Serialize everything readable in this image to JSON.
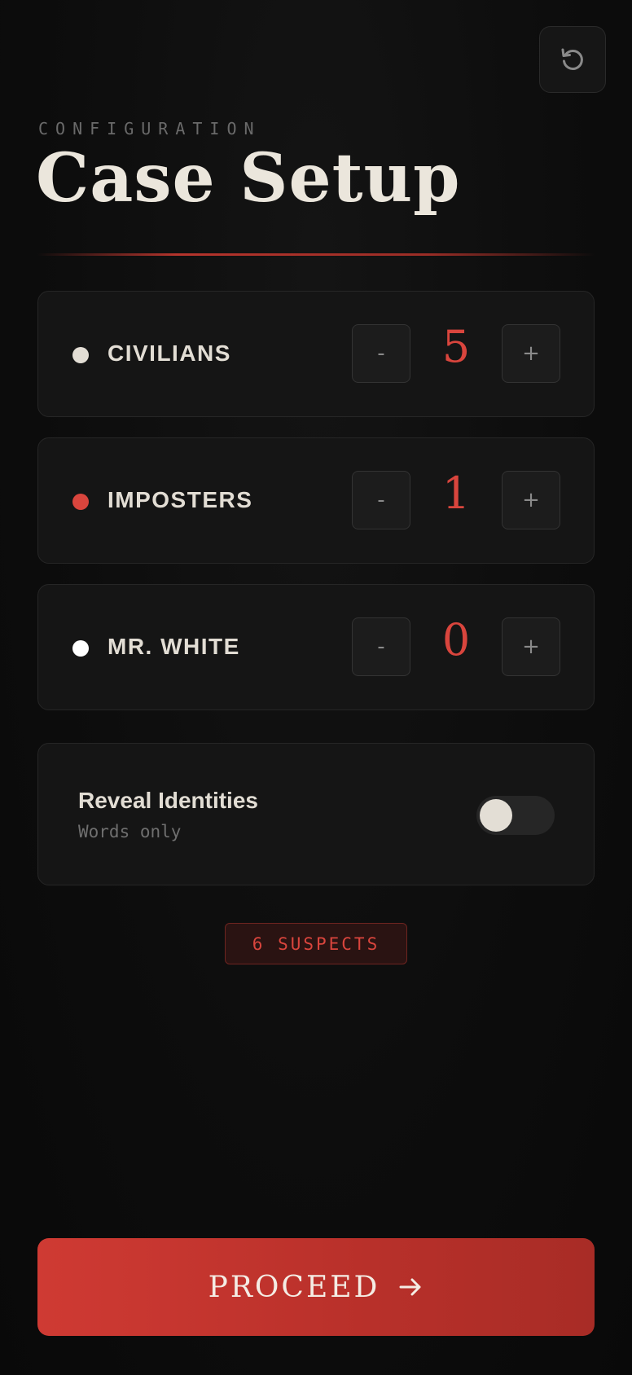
{
  "header": {
    "eyebrow": "CONFIGURATION",
    "title": "Case Setup",
    "reset_icon": "reset-icon"
  },
  "roles": [
    {
      "label": "CIVILIANS",
      "count": "5",
      "dot_color": "#e3ded5",
      "minus": "-",
      "plus": "+"
    },
    {
      "label": "IMPOSTERS",
      "count": "1",
      "dot_color": "#d9453d",
      "minus": "-",
      "plus": "+"
    },
    {
      "label": "MR. WHITE",
      "count": "0",
      "dot_color": "#ffffff",
      "minus": "-",
      "plus": "+"
    }
  ],
  "reveal": {
    "title": "Reveal Identities",
    "subtitle": "Words only",
    "enabled": false
  },
  "suspects_badge": "6 SUSPECTS",
  "proceed": {
    "label": "PROCEED",
    "icon": "arrow-right-icon"
  },
  "colors": {
    "accent": "#d9453d",
    "background": "#0c0c0c",
    "card": "#151515"
  }
}
